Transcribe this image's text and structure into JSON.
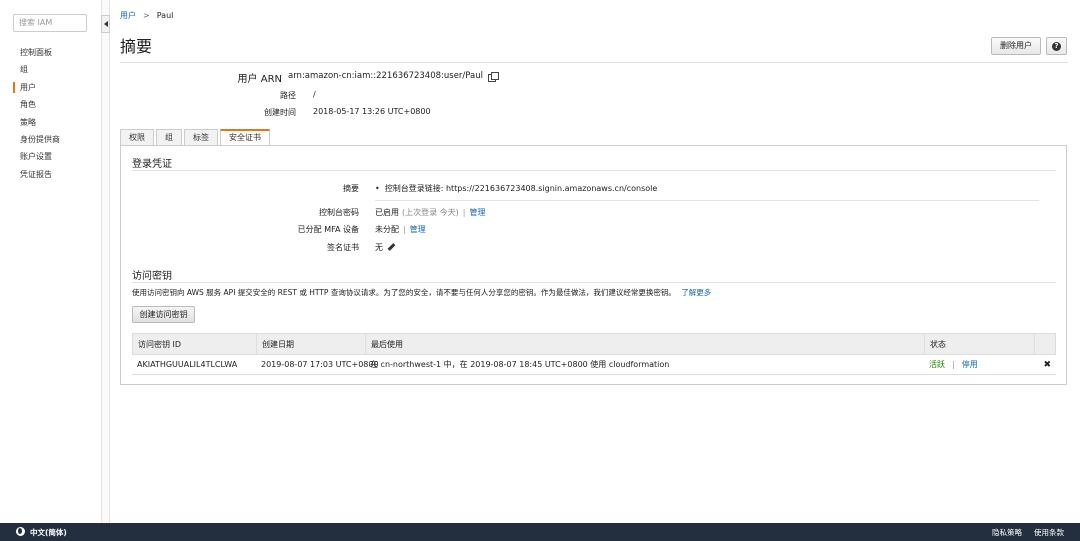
{
  "sidebar": {
    "search_placeholder": "搜索 IAM",
    "items": [
      {
        "label": "控制面板"
      },
      {
        "label": "组"
      },
      {
        "label": "用户"
      },
      {
        "label": "角色"
      },
      {
        "label": "策略"
      },
      {
        "label": "身份提供商"
      },
      {
        "label": "账户设置"
      },
      {
        "label": "凭证报告"
      }
    ],
    "active_index": 2
  },
  "breadcrumb": {
    "parent": "用户",
    "separator": ">",
    "current": "Paul"
  },
  "page_title": "摘要",
  "actions": {
    "delete_user": "删除用户",
    "help": "?"
  },
  "summary": {
    "arn_label": "用户 ARN",
    "arn_value": "arn:amazon-cn:iam::221636723408:user/Paul",
    "path_label": "路径",
    "path_value": "/",
    "created_label": "创建时间",
    "created_value": "2018-05-17 13:26 UTC+0800"
  },
  "tabs": [
    {
      "label": "权限"
    },
    {
      "label": "组"
    },
    {
      "label": "标签"
    },
    {
      "label": "安全证书"
    }
  ],
  "active_tab": 3,
  "login_credentials": {
    "title": "登录凭证",
    "summary_label": "摘要",
    "summary_bullet": "•",
    "summary_value": "控制台登录链接: https://221636723408.signin.amazonaws.cn/console",
    "console_password_label": "控制台密码",
    "console_password_value": "已启用",
    "console_password_note": "(上次登录 今天)",
    "manage_label": "管理",
    "mfa_label": "已分配 MFA 设备",
    "mfa_value": "未分配",
    "cert_label": "签名证书",
    "cert_value": "无"
  },
  "access_keys": {
    "title": "访问密钥",
    "description": "使用访问密钥向 AWS 服务 API 提交安全的 REST 或 HTTP 查询协议请求。为了您的安全，请不要与任何人分享您的密钥。作为最佳做法，我们建议经常更换密钥。",
    "learn_more": "了解更多",
    "create_button": "创建访问密钥",
    "columns": [
      "访问密钥 ID",
      "创建日期",
      "最后使用",
      "状态"
    ],
    "rows": [
      {
        "id": "AKIATHGUUALIL4TLCLWA",
        "created": "2019-08-07 17:03 UTC+0800",
        "last_used": "在 cn-northwest-1 中，在 2019-08-07 18:45 UTC+0800 使用 cloudformation",
        "status": "活跃",
        "status_action": "停用",
        "delete": "✖"
      }
    ]
  },
  "footer": {
    "language": "中文(简体)",
    "privacy": "隐私策略",
    "terms": "使用条款"
  },
  "colors": {
    "accent": "#e47911",
    "link": "#1166bb",
    "footer_bg": "#232f3e",
    "active_status": "#1d8102"
  }
}
